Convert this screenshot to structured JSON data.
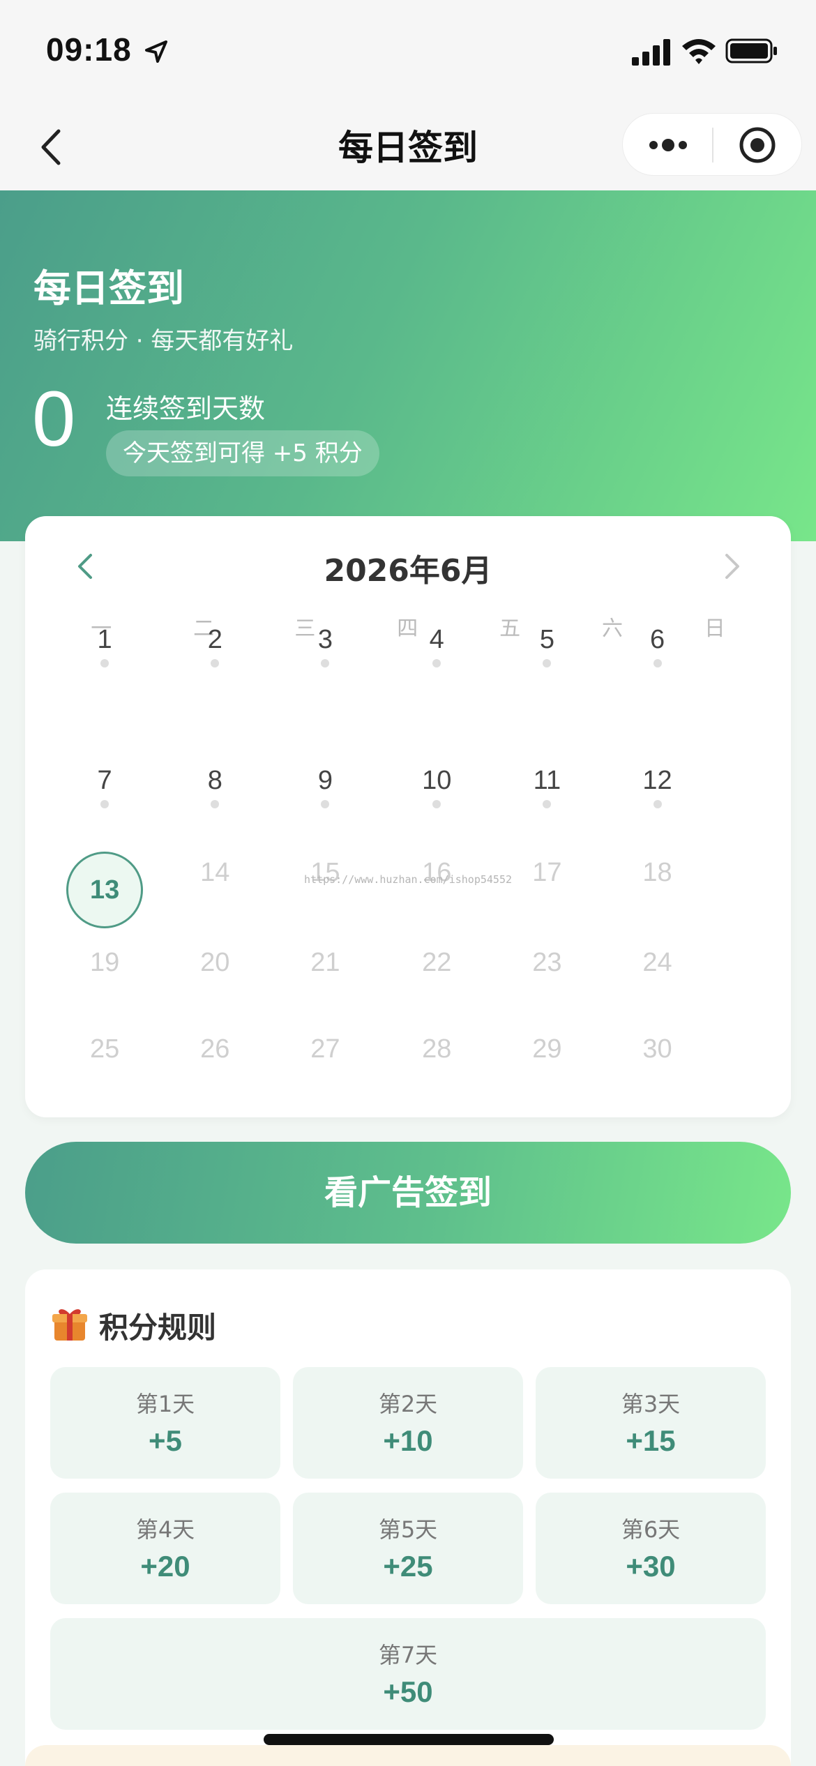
{
  "status_bar": {
    "time": "09:18"
  },
  "nav": {
    "title": "每日签到"
  },
  "hero": {
    "title": "每日签到",
    "subtitle": "骑行积分 · 每天都有好礼",
    "streak_count": "0",
    "streak_label": "连续签到天数",
    "reward_text": "今天签到可得 +5 积分"
  },
  "calendar": {
    "month_label": "2026年6月",
    "weekdays": [
      "一",
      "二",
      "三",
      "四",
      "五",
      "六",
      "日"
    ],
    "today": "13",
    "days": [
      "1",
      "2",
      "3",
      "4",
      "5",
      "6",
      "7",
      "8",
      "9",
      "10",
      "11",
      "12",
      "13",
      "14",
      "15",
      "16",
      "17",
      "18",
      "19",
      "20",
      "21",
      "22",
      "23",
      "24",
      "25",
      "26",
      "27",
      "28",
      "29",
      "30"
    ],
    "watermark": "https://www.huzhan.com/ishop54552"
  },
  "sign_button": {
    "label": "看广告签到"
  },
  "rules": {
    "title": "积分规则",
    "tiles": [
      {
        "day": "第1天",
        "points": "+5"
      },
      {
        "day": "第2天",
        "points": "+10"
      },
      {
        "day": "第3天",
        "points": "+15"
      },
      {
        "day": "第4天",
        "points": "+20"
      },
      {
        "day": "第5天",
        "points": "+25"
      },
      {
        "day": "第6天",
        "points": "+30"
      },
      {
        "day": "第7天",
        "points": "+50"
      }
    ]
  },
  "colors": {
    "accent": "#4f9b86",
    "gradient_start": "#4b9e8a",
    "gradient_end": "#78e68a",
    "tile_bg": "#eef6f2"
  }
}
